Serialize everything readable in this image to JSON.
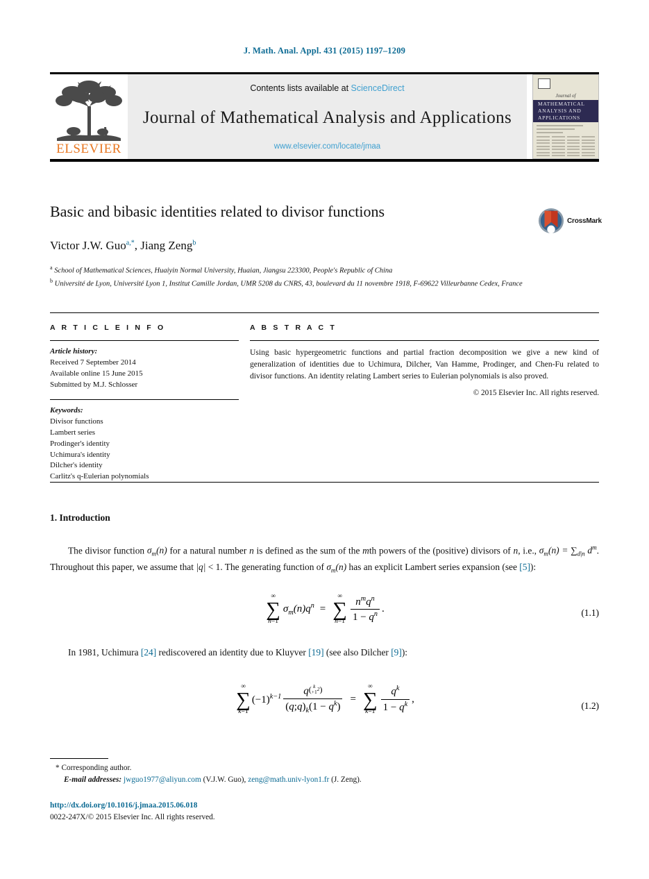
{
  "running_head": "J. Math. Anal. Appl. 431 (2015) 1197–1209",
  "masthead": {
    "contents_prefix": "Contents lists available at ",
    "sciencedirect": "ScienceDirect",
    "journal_title": "Journal of Mathematical Analysis and Applications",
    "journal_url": "www.elsevier.com/locate/jmaa",
    "publisher_wordmark": "ELSEVIER",
    "cover": {
      "journal_of": "Journal of",
      "line1": "MATHEMATICAL",
      "line2": "ANALYSIS AND",
      "line3": "APPLICATIONS"
    }
  },
  "crossmark": {
    "label": "CrossMark"
  },
  "article": {
    "title": "Basic and bibasic identities related to divisor functions",
    "authors_html": "Victor J.W. Guo<sup>a,*</sup>, Jiang Zeng<sup>b</sup>",
    "affiliation_a": "School of Mathematical Sciences, Huaiyin Normal University, Huaian, Jiangsu 223300, People's Republic of China",
    "affiliation_b": "Université de Lyon, Université Lyon 1, Institut Camille Jordan, UMR 5208 du CNRS, 43, boulevard du 11 novembre 1918, F-69622 Villeurbanne Cedex, France"
  },
  "info": {
    "heading": "A R T I C L E    I N F O",
    "history_label": "Article history:",
    "history": [
      "Received 7 September 2014",
      "Available online 15 June 2015",
      "Submitted by M.J. Schlosser"
    ],
    "keywords_label": "Keywords:",
    "keywords": [
      "Divisor functions",
      "Lambert series",
      "Prodinger's identity",
      "Uchimura's identity",
      "Dilcher's identity",
      "Carlitz's q-Eulerian polynomials"
    ]
  },
  "abstract": {
    "heading": "A B S T R A C T",
    "text": "Using basic hypergeometric functions and partial fraction decomposition we give a new kind of generalization of identities due to Uchimura, Dilcher, Van Hamme, Prodinger, and Chen-Fu related to divisor functions. An identity relating Lambert series to Eulerian polynomials is also proved.",
    "copyright": "© 2015 Elsevier Inc. All rights reserved."
  },
  "body": {
    "section_heading": "1. Introduction",
    "paragraph1_parts": {
      "p1": "The divisor function ",
      "p2": " for a natural number ",
      "p3": " is defined as the sum of the ",
      "p4": "th powers of the (positive) divisors of ",
      "p5": ", i.e., ",
      "p6": ". Throughout this paper, we assume that ",
      "p7": " < 1. The generating function of ",
      "p8": " has an explicit Lambert series expansion (see ",
      "ref5": "[5]",
      "p9": "):"
    },
    "eq1_number": "(1.1)",
    "paragraph2_parts": {
      "p1": "In 1981, Uchimura ",
      "ref24": "[24]",
      "p2": " rediscovered an identity due to Kluyver ",
      "ref19": "[19]",
      "p3": " (see also Dilcher ",
      "ref9": "[9]",
      "p4": "):"
    },
    "eq2_number": "(1.2)"
  },
  "footnotes": {
    "corresponding": "* Corresponding author.",
    "email_label": "E-mail addresses:",
    "email1": "jwguo1977@aliyun.com",
    "email1_owner": "(V.J.W. Guo),",
    "email2": "zeng@math.univ-lyon1.fr",
    "email2_owner": "(J. Zeng).",
    "doi": "http://dx.doi.org/10.1016/j.jmaa.2015.06.018",
    "issn": "0022-247X/© 2015 Elsevier Inc. All rights reserved."
  },
  "colors": {
    "link": "#0b6a93",
    "sciencedirect": "#3fa0d0",
    "elsevier_orange": "#E87722",
    "cover_band": "#2d2a52"
  }
}
